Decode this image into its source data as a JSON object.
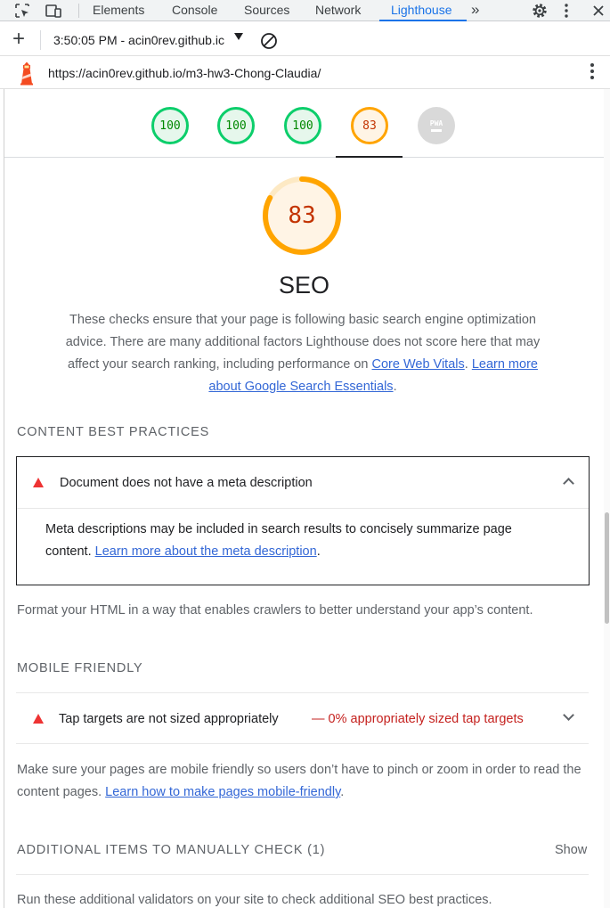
{
  "devtools": {
    "tabs": [
      {
        "label": "Elements"
      },
      {
        "label": "Console"
      },
      {
        "label": "Sources"
      },
      {
        "label": "Network"
      },
      {
        "label": "Lighthouse",
        "active": true
      }
    ],
    "more_tabs_glyph": "»",
    "accent_color": "#1a73e8"
  },
  "report_bar": {
    "add_glyph": "+",
    "selected_report": "3:50:05 PM - acin0rev.github.ic"
  },
  "url_bar": {
    "url": "https://acin0rev.github.io/m3-hw3-Chong-Claudia/"
  },
  "gauges": [
    {
      "score": "100",
      "status": "pass"
    },
    {
      "score": "100",
      "status": "pass"
    },
    {
      "score": "100",
      "status": "pass"
    },
    {
      "score": "83",
      "status": "average",
      "active": true
    },
    {
      "score": "PWA",
      "status": "na"
    }
  ],
  "seo": {
    "score": "83",
    "score_fraction": 0.83,
    "title": "SEO",
    "desc_text": "These checks ensure that your page is following basic search engine optimization advice. There are many additional factors Lighthouse does not score here that may affect your search ranking, including performance on ",
    "link_cwv": "Core Web Vitals",
    "desc_mid": ". ",
    "link_essentials": "Learn more about Google Search Essentials",
    "desc_end": "."
  },
  "content_best_practices": {
    "title": "CONTENT BEST PRACTICES",
    "audit": {
      "title": "Document does not have a meta description",
      "desc_text": "Meta descriptions may be included in search results to concisely summarize page content. ",
      "link": "Learn more about the meta description",
      "desc_end": "."
    },
    "group_desc": "Format your HTML in a way that enables crawlers to better understand your app’s content."
  },
  "mobile_friendly": {
    "title": "MOBILE FRIENDLY",
    "audit": {
      "title": "Tap targets are not sized appropriately",
      "display_value": "— 0% appropriately sized tap targets"
    },
    "desc_text": "Make sure your pages are mobile friendly so users don’t have to pinch or zoom in order to read the content pages. ",
    "link": "Learn how to make pages mobile-friendly",
    "desc_end": "."
  },
  "manual_check": {
    "title": "ADDITIONAL ITEMS TO MANUALLY CHECK (1)",
    "toggle": "Show",
    "desc": "Run these additional validators on your site to check additional SEO best practices."
  },
  "colors": {
    "pass": "#0cce6b",
    "average": "#ffa400",
    "fail": "#eb3333",
    "link": "#3367d6"
  }
}
